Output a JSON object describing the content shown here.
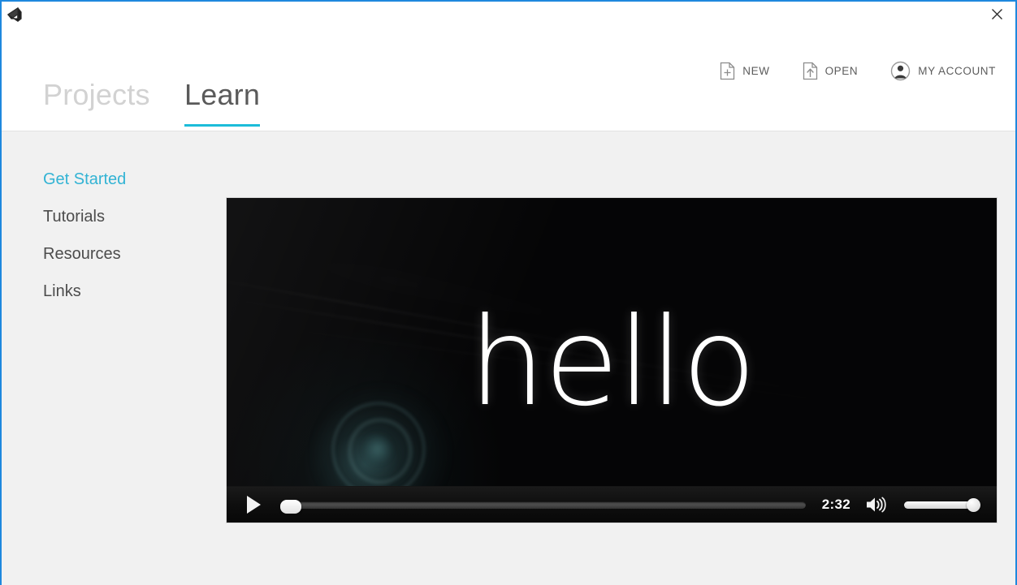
{
  "window": {
    "logo_icon": "unity-logo-icon",
    "close_icon": "close-icon",
    "border_color": "#1E88DE"
  },
  "header": {
    "tabs": [
      {
        "label": "Projects",
        "active": false
      },
      {
        "label": "Learn",
        "active": true
      }
    ],
    "active_underline_color": "#1CBCD9",
    "actions": [
      {
        "label": "NEW",
        "icon": "new-document-icon"
      },
      {
        "label": "OPEN",
        "icon": "open-document-icon"
      },
      {
        "label": "MY ACCOUNT",
        "icon": "user-account-icon"
      }
    ]
  },
  "sidebar": {
    "items": [
      {
        "label": "Get Started",
        "active": true
      },
      {
        "label": "Tutorials",
        "active": false
      },
      {
        "label": "Resources",
        "active": false
      },
      {
        "label": "Links",
        "active": false
      }
    ],
    "active_color": "#32B3D4"
  },
  "video": {
    "title_text": "hello",
    "controls": {
      "play_icon": "play-icon",
      "time": "2:32",
      "volume_icon": "speaker-volume-icon",
      "progress_percent": 0,
      "volume_percent": 100
    }
  }
}
